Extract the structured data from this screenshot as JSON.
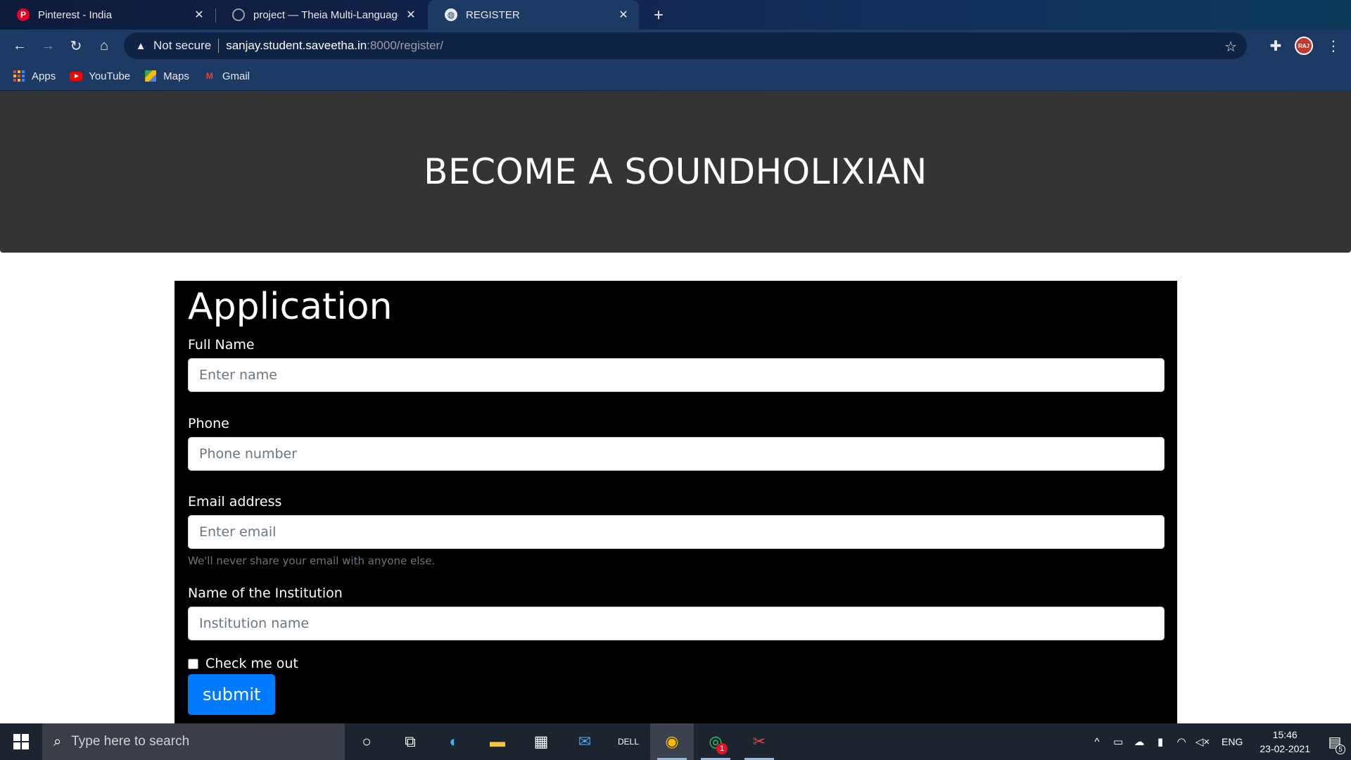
{
  "browser": {
    "tabs": [
      {
        "title": "Pinterest - India",
        "favicon": "pinterest-icon",
        "active": false
      },
      {
        "title": "project — Theia Multi-Language",
        "favicon": "globe-icon",
        "active": false
      },
      {
        "title": "REGISTER",
        "favicon": "globe-icon",
        "active": true
      }
    ],
    "address": {
      "security_label": "Not secure",
      "host": "sanjay.student.saveetha.in",
      "path": ":8000/register/"
    },
    "profile_initials": "RAJ",
    "bookmarks": [
      {
        "label": "Apps",
        "icon": "apps-grid-icon"
      },
      {
        "label": "YouTube",
        "icon": "youtube-icon"
      },
      {
        "label": "Maps",
        "icon": "maps-icon"
      },
      {
        "label": "Gmail",
        "icon": "gmail-icon"
      }
    ]
  },
  "page": {
    "hero_title": "BECOME A SOUNDHOLIXIAN",
    "form": {
      "heading": "Application",
      "fields": {
        "name": {
          "label": "Full Name",
          "placeholder": "Enter name"
        },
        "phone": {
          "label": "Phone",
          "placeholder": "Phone number"
        },
        "email": {
          "label": "Email address",
          "placeholder": "Enter email",
          "help": "We'll never share your email with anyone else."
        },
        "institution": {
          "label": "Name of the Institution",
          "placeholder": "Institution name"
        }
      },
      "checkbox_label": "Check me out",
      "submit_label": "submit"
    }
  },
  "taskbar": {
    "search_placeholder": "Type here to search",
    "language": "ENG",
    "time": "15:46",
    "date": "23-02-2021",
    "whatsapp_badge": "1",
    "notification_count": "5"
  },
  "colors": {
    "hero_bg": "#343434",
    "form_bg": "#000000",
    "submit_bg": "#007bff"
  }
}
